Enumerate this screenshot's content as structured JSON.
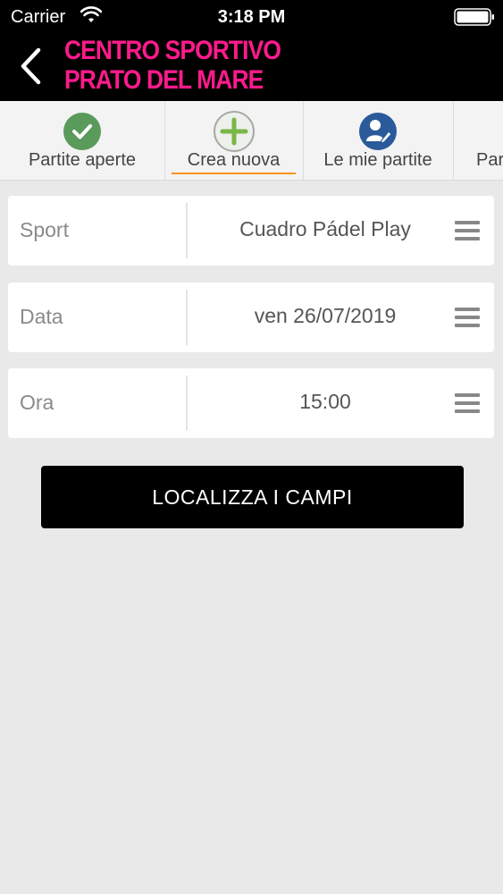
{
  "status_bar": {
    "carrier": "Carrier",
    "time": "3:18 PM"
  },
  "header": {
    "logo_line1": "CENTRO SPORTIVO",
    "logo_line2": "PRATO DEL MARE",
    "logo_color": "#ff1a8c"
  },
  "tabs": [
    {
      "label": "Partite aperte",
      "icon": "check-icon",
      "color": "#5a9a5a"
    },
    {
      "label": "Crea nuova",
      "icon": "plus-icon",
      "color": "#7ab648",
      "selected": true
    },
    {
      "label": "Le mie partite",
      "icon": "user-edit-icon",
      "color": "#2a5a9a"
    },
    {
      "label": "Par",
      "icon": ""
    }
  ],
  "form": {
    "sport": {
      "label": "Sport",
      "value": "Cuadro Pádel Play"
    },
    "date": {
      "label": "Data",
      "value": "ven 26/07/2019"
    },
    "time": {
      "label": "Ora",
      "value": "15:00"
    }
  },
  "actions": {
    "locate_label": "LOCALIZZA I CAMPI"
  },
  "colors": {
    "accent": "#f7931e",
    "header_bg": "#000000"
  }
}
